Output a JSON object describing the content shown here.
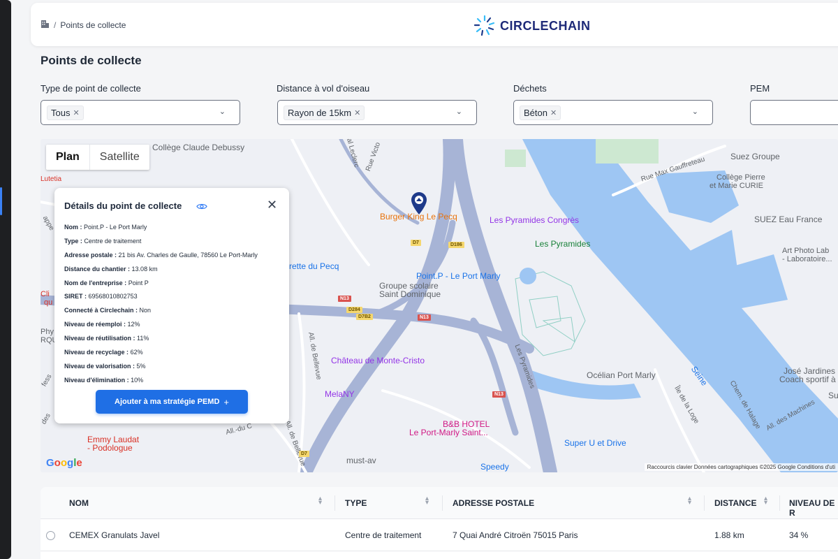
{
  "breadcrumb": {
    "current": "Points de collecte"
  },
  "brand": {
    "name": "CIRCLECHAIN"
  },
  "page": {
    "title": "Points de collecte"
  },
  "filters": [
    {
      "label": "Type de point de collecte",
      "chip": "Tous"
    },
    {
      "label": "Distance à vol d'oiseau",
      "chip": "Rayon de 15km"
    },
    {
      "label": "Déchets",
      "chip": "Béton"
    },
    {
      "label": "PEM",
      "chip": ""
    }
  ],
  "map": {
    "type_controls": {
      "plan": "Plan",
      "satellite": "Satellite"
    },
    "pois": {
      "college": "Collège Claude Debussy",
      "lutetia": "Lutetia",
      "suez_groupe": "Suez Groupe",
      "college_curie_1": "Collège Pierre",
      "college_curie_2": "et Marie CURIE",
      "suez_eau": "SUEZ Eau France",
      "art_photo_1": "Art Photo Lab",
      "art_photo_2": "- Laboratoire...",
      "burger": "Burger King Le Pecq",
      "pyr_congres": "Les Pyramides Congrès",
      "pyramides": "Les Pyramides",
      "pointp": "Point.P - Le Port Marly",
      "pecq": "rette du Pecq",
      "groupe_1": "Groupe scolaire",
      "groupe_2": "Saint Dominique",
      "monte_cristo": "Château de Monte-Cristo",
      "melany": "MelaNY",
      "ocelian": "Océlian Port Marly",
      "jardines_1": "José Jardines",
      "jardines_2": "Coach sportif à",
      "bb_1": "B&B HOTEL",
      "bb_2": "Le Port-Marly Saint...",
      "superu": "Super U et Drive",
      "emmy_1": "Emmy Laudat",
      "emmy_2": "- Podologue",
      "mustav": "must-av",
      "speedy": "Speedy",
      "phy": "Phy",
      "rqu": "RQU",
      "cli": "Cli",
      "qu": "qu",
      "su": "Su"
    },
    "roads": {
      "max_gauffreteau": "Rue Max Gauffreteau",
      "leclerc": "éral Leclerc",
      "victor": "Rue Victo",
      "seine": "Seine",
      "pyramides_rd": "Les Pyramides",
      "belleville": "All. de Bellevue",
      "belleville2": "All. de Bellevue",
      "loge": "Île de la Loge",
      "halage": "Chem. de Halage",
      "machines": "All. des Machines",
      "alldu": "All.-du C",
      "appe": "appe",
      "fess": "fess",
      "des": "des"
    },
    "shields": {
      "d7": "D7",
      "d186": "D186",
      "n13a": "N13",
      "d284": "D284",
      "d7b2": "D7B2",
      "n13b": "N13",
      "n13c": "N13",
      "d7b": "D7"
    },
    "google": "Google",
    "attribution": "Raccourcis clavier   Données cartographiques ©2025 Google   Conditions d'uti"
  },
  "detail": {
    "title": "Détails du point de collecte",
    "rows": [
      {
        "label": "Nom :",
        "value": "Point.P - Le Port Marly"
      },
      {
        "label": "Type :",
        "value": "Centre de traitement"
      },
      {
        "label": "Adresse postale :",
        "value": "21 bis Av. Charles de Gaulle, 78560 Le Port-Marly"
      },
      {
        "label": "Distance du chantier :",
        "value": "13.08 km"
      },
      {
        "label": "Nom de l'entreprise :",
        "value": "Point P"
      },
      {
        "label": "SIRET :",
        "value": "69568010802753"
      },
      {
        "label": "Connecté à Circlechain :",
        "value": "Non"
      },
      {
        "label": "Niveau de réemploi :",
        "value": "12%"
      },
      {
        "label": "Niveau de réutilisation :",
        "value": "11%"
      },
      {
        "label": "Niveau de recyclage :",
        "value": "62%"
      },
      {
        "label": "Niveau de valorisation :",
        "value": "5%"
      },
      {
        "label": "Niveau d'élimination :",
        "value": "10%"
      }
    ],
    "button": "Ajouter à ma stratégie PEMD",
    "button_icon": "+"
  },
  "table": {
    "headers": {
      "nom": "NOM",
      "type": "TYPE",
      "adresse": "ADRESSE POSTALE",
      "distance": "DISTANCE",
      "niveau": "NIVEAU DE R"
    },
    "rows": [
      {
        "nom": "CEMEX Granulats Javel",
        "type": "Centre de traitement",
        "adresse": "7 Quai André Citroën 75015 Paris",
        "distance": "1.88 km",
        "niveau": "34 %"
      }
    ]
  }
}
